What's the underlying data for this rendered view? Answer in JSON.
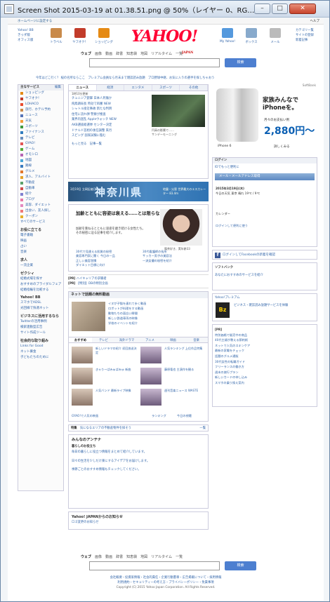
{
  "window": {
    "title": "Screen Shot 2015-03-19 at 01.38.51.png @ 50%（レイヤー 0、RG…",
    "min": "–",
    "max": "□",
    "close": "✕"
  },
  "topbar": {
    "home": "ホームページに設定する",
    "help": "ヘルプ"
  },
  "header": {
    "leftlinks": [
      "Yahoo! BB",
      "きっず版",
      "オフィス版"
    ],
    "services": [
      {
        "label": "トラベル",
        "color": "#c98a4a"
      },
      {
        "label": "ヤフオク！",
        "color": "#c23c2a"
      },
      {
        "label": "ショッピング",
        "color": "#e58a14"
      }
    ],
    "logo": "YAHOO!",
    "logo_sub": "JAPAN",
    "services2": [
      {
        "label": "My Yahoo!",
        "color": "#5599dd"
      },
      {
        "label": "ボックス",
        "color": "#88aacc"
      },
      {
        "label": "メール",
        "color": "#bbbbbb"
      }
    ],
    "rightlinks": [
      "カテゴリ一覧",
      "サイトの登録",
      "新着記事"
    ]
  },
  "search": {
    "tabs": [
      "ウェブ",
      "画像",
      "動画",
      "辞書",
      "知恵袋",
      "地図",
      "リアルタイム",
      "一覧"
    ],
    "button": "検索"
  },
  "alerts": "今年はどこ行く？ 桜の名所ならここ　プレミアム会員なら月末まで雑誌読み放題　プロ野球中継、お気に入りの選手を探しちゃおう",
  "left": {
    "head": "主なサービス",
    "edit": "編集",
    "items": [
      {
        "label": "ショッピング",
        "color": "#e58a14"
      },
      {
        "label": "ヤフオク！",
        "color": "#c23c2a"
      },
      {
        "label": "LOHACO",
        "color": "#e94b2e"
      },
      {
        "label": "旅行、ホテル予約",
        "color": "#c98a4a"
      },
      {
        "label": "ニュース",
        "color": "#5574b8"
      },
      {
        "label": "天気",
        "color": "#f29b38"
      },
      {
        "label": "スポーツ",
        "color": "#3e9a3e"
      },
      {
        "label": "ファイナンス",
        "color": "#2e7bbf"
      },
      {
        "label": "テレビ",
        "color": "#6a8fc0"
      },
      {
        "label": "GYAO!",
        "color": "#e25555"
      },
      {
        "label": "ゲーム",
        "color": "#56aa3a"
      },
      {
        "label": "オモシロ",
        "color": "#b564b4"
      },
      {
        "label": "地図",
        "color": "#4aa6d8"
      },
      {
        "label": "路線",
        "color": "#3a7bbf"
      },
      {
        "label": "グルメ",
        "color": "#e2772b"
      },
      {
        "label": "求人、アルバイト",
        "color": "#e6a32c"
      },
      {
        "label": "不動産",
        "color": "#5aa16a"
      },
      {
        "label": "自動車",
        "color": "#d04c4c"
      },
      {
        "label": "紹介",
        "color": "#7f7fd0"
      },
      {
        "label": "ブログ",
        "color": "#e87aa8"
      },
      {
        "label": "美容、ダイエット",
        "color": "#e489c0"
      },
      {
        "label": "出会い、友人探し",
        "color": "#f07878"
      },
      {
        "label": "クーポン",
        "color": "#e6b02c"
      }
    ],
    "more": "すべてのサービス",
    "sec1": "お役に立てる",
    "sec1items": [
      "電子書籍",
      "映画",
      "占い",
      "音楽"
    ],
    "sec2": "求人",
    "sec2items": [
      "転職",
      "派遣",
      "転職",
      "求人情報",
      "一流企業"
    ],
    "sec3": "ゼクシィ",
    "sec3items": [
      "結婚式場を探す",
      "おすすめのプライダルフェア",
      "結婚指輪を比較する"
    ],
    "sec4": "Yahoo! BB",
    "sec4items": [
      "スマホでADSL",
      "光回線で快適ネット"
    ],
    "sec5": "ビジネスに活用するなら",
    "sec5items": [
      "Twitterの活用事例",
      "検索連動型広告",
      "サイト作成ツール"
    ],
    "sec6": "社会的な取り組み",
    "sec6items": [
      "Links for Good",
      "ネット募金",
      "子どもたちのために"
    ]
  },
  "news": {
    "tabs": [
      "ニュース",
      "経済",
      "エンタメ",
      "スポーツ",
      "その他"
    ],
    "time": "1時10分更新",
    "items": [
      "チュニジア銃撃 日本人死傷か",
      "飛鳥鶏局長 時効で再審 NEW",
      "シャトル接近事故 新たな判明",
      "住宅に流れ弾 警察が捜査",
      "業界内混乱 Appleウォッチ NEW",
      "AKB選抜総選挙 センター決定",
      "ドナルド首相の後任調整 来月",
      "スピング 国家試験に臨む"
    ],
    "more": "もっと見る",
    "more2": "記事一覧",
    "caption1": "円高の影響で……",
    "caption2": "サンデーモーニング"
  },
  "banner": {
    "left": "3月19日 立岡記者日",
    "title": "神奈川県",
    "right": "地震・災害 世界最大のエスカレーター 83.4m"
  },
  "feature": {
    "headline": "加齢とともに容姿は衰える……とは限らない？",
    "body": "加齢を重ねるとともに容姿を磨き続ける女性たち。その秘密に迫る記事を紹介します。",
    "caption": "喫茶好き、実年齢33",
    "links": [
      "30代で見違える肌質の秘密",
      "美容専門家に聞く 今日の一品",
      "正しい美容習慣",
      "ダイエット目標に向け",
      "30代看護師の長所",
      "サッカー男子の美容法",
      "一流女優の秘密を紹介"
    ]
  },
  "pr1": {
    "label": "[PR]",
    "text1": "ハイキャリアの求職者",
    "text2": "【特別】DBの特別企画"
  },
  "net": {
    "head": "ネットで話題の無料動画",
    "items": [
      "イヌが子猫を連れて歩く動画",
      "ロボットが料理をする動画",
      "動物たちの面白い瞬間",
      "新しい鉄道車両の映像",
      "学校のイベントを紹介"
    ],
    "tabs": [
      "おすすめ",
      "テレビ",
      "海外ドラマ",
      "アニメ",
      "映画",
      "音楽"
    ],
    "os": [
      {
        "t1": "新しいドラマの紹介 初回放送決定",
        "t2": "人気ランキング 上位作品特集"
      },
      {
        "t1": "きゃりーぱみゅぱみゅ 新曲",
        "t2": "藤原竜也 主演作を観る"
      },
      {
        "t1": "人気バンド 最新ライブ映像",
        "t2": "週刊音楽ニュース WASTE"
      }
    ],
    "more1": "GYAO!で人気の映画",
    "ranking": "ランキング",
    "today": "今日の視聴"
  },
  "tokusyu": {
    "label": "特集",
    "text": "気になるエリアの不動産物件を探そう",
    "more": "一覧"
  },
  "antenna": {
    "title": "みんなのアンテナ",
    "sub": "暮らしのお役立ち",
    "p1": "毎日の暮らしに役立つ情報をまとめて紹介しています。",
    "p2": "日々の生活を少しだけ楽にするアイデアをお届けします。",
    "p3": "季節ごとのおすすめ情報もチェックしてください。"
  },
  "yjapan": {
    "title": "Yahoo! JAPANからのお知らせ",
    "text": "ロゴ変更のお知らせ"
  },
  "ad": {
    "top": "SoftBank",
    "t1": "家族みんなで\niPhoneを。",
    "t2": "月々のお支払い例",
    "price": "2,880円〜",
    "cap": "iPhone 6",
    "more": "詳しくみる"
  },
  "login": {
    "head": "ログイン",
    "sub": "IDでもっと便利に",
    "mail": "メール・メールアドレス取得",
    "date": "2015年3月19日(木)",
    "weather": "今日の天気 東京 晴れ 19℃ / 9℃",
    "cal": "カレンダー",
    "news": "ログインして便利に使う"
  },
  "fb": "ログインしてFacebookの新着を確認",
  "softbank": {
    "title": "ソフトバンク",
    "text": "あなたにおすすめのサービスを紹介"
  },
  "premium": {
    "title": "Yahoo!プレミアム",
    "text": "ビジネス・雑誌読み放題サービスを体験",
    "bz": "Bz"
  },
  "prlist": {
    "label": "[PR]",
    "items": [
      "特別価格で販売中の商品",
      "40代主婦が教える節約術",
      "ネットで人気のスキンケア",
      "最新の家電をチェック",
      "話題のグルメ通販",
      "30代女性の転職ガイド",
      "フリーランスの働き方",
      "週末の旅行プラン",
      "新しいカードの申し込み",
      "スマホの乗り換え案内"
    ]
  },
  "footer": {
    "links1": "会社概要・投資家情報・社会的責任・企業行動憲章・広告掲載について・採用情報",
    "links2": "利用規約・セキュリティーの考え方・プライバシーポリシー・免責事項",
    "copyright": "Copyright (C) 2015 Yahoo Japan Corporation. All Rights Reserved."
  }
}
